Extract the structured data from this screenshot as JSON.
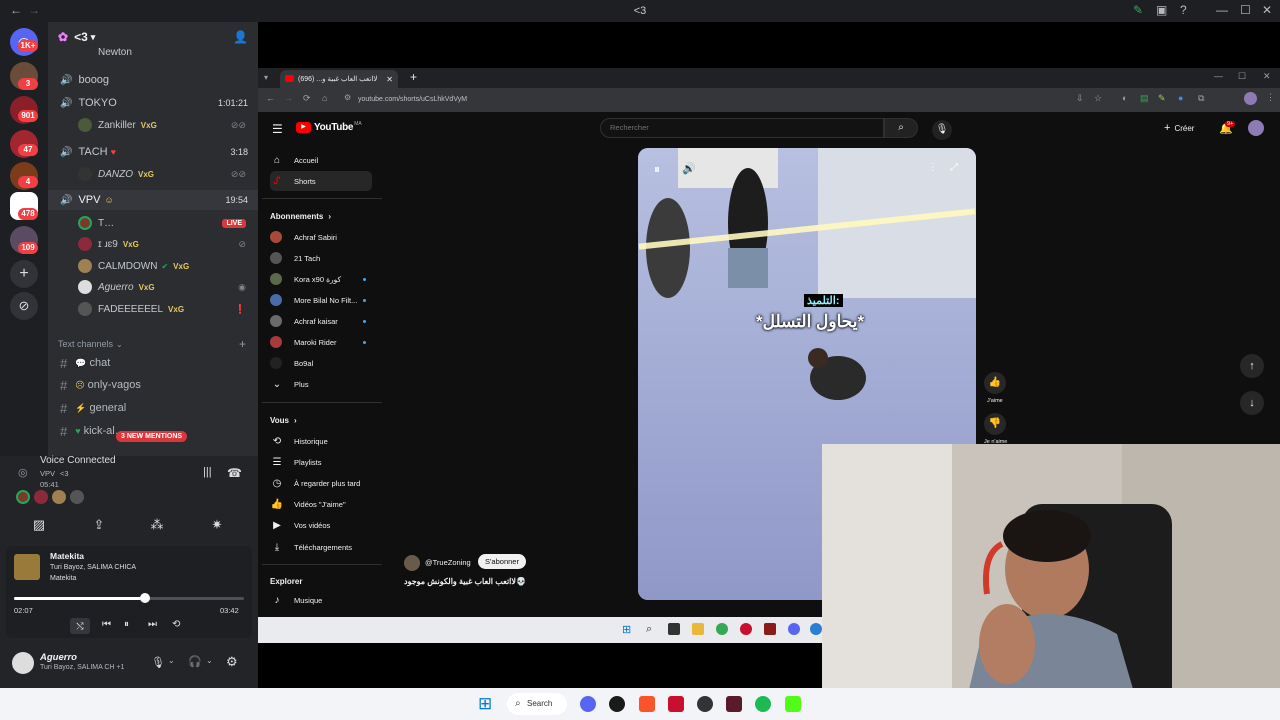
{
  "window": {
    "title": "<3"
  },
  "rail": {
    "badges": [
      "1K+",
      "3",
      "901",
      "47",
      "4",
      "478",
      "109"
    ]
  },
  "server": {
    "name": "<3",
    "top_cut_user": "Newton",
    "voice_channels": [
      {
        "name": "booog",
        "time": ""
      },
      {
        "name": "TOKYO",
        "time": "1:01:21"
      },
      {
        "name": "TACH",
        "time": "3:18"
      },
      {
        "name": "VPV",
        "time": "19:54"
      }
    ],
    "tokyo_user": {
      "name": "Zankiller",
      "tag": "VxG"
    },
    "tach_user": {
      "name": "DANZO",
      "tag": "VxG"
    },
    "vpv_users": [
      {
        "name": "T…",
        "tag": "",
        "live": "LIVE"
      },
      {
        "name": "ɪ ɹɛ9",
        "tag": "VxG",
        "live": ""
      },
      {
        "name": "CALMDOWN",
        "tag": "VxG",
        "live": ""
      },
      {
        "name": "Aguerro",
        "tag": "VxG",
        "live": ""
      },
      {
        "name": "FADEEEEEEL",
        "tag": "VxG",
        "live": ""
      }
    ],
    "text_channels_header": "Text channels",
    "text_channels": [
      "chat",
      "only-vagos",
      "general",
      "kick-al…"
    ],
    "mentions_badge": "3 NEW MENTIONS"
  },
  "voice": {
    "status": "Voice Connected",
    "channel": "VPV",
    "server": "<3",
    "elapsed": "05:41"
  },
  "spotify": {
    "track": "Matekita",
    "artists": "Turi Bayoz, SALIMA CHICA",
    "album": "Matekita",
    "position": "02:07",
    "duration": "03:42",
    "progress_fraction": 0.57
  },
  "user": {
    "name": "Aguerro",
    "activity": "Turi Bayoz, SALIMA CH +1"
  },
  "browser": {
    "tab_title": "لااتعب العاب غبية و... (696)",
    "new_tab": "+",
    "url": "youtube.com/shorts/uCsLhkVdVyM"
  },
  "youtube": {
    "logo": "YouTube",
    "logo_sup": "MA",
    "search_placeholder": "Rechercher",
    "create_label": "Créer",
    "notif_count": "9+",
    "nav": [
      {
        "icon": "home-icon",
        "label": "Accueil"
      },
      {
        "icon": "shorts-icon",
        "label": "Shorts"
      }
    ],
    "subs_header": "Abonnements",
    "subs": [
      "Achraf Sabiri",
      "21 Tach",
      "Kora x90 كورة",
      "More Bilal No Filt...",
      "Achraf kaisar",
      "Maroki Rider",
      "Bo9al"
    ],
    "more_label": "Plus",
    "you_header": "Vous",
    "you_items": [
      "Historique",
      "Playlists",
      "À regarder plus tard",
      "Vidéos \"J'aime\"",
      "Vos vidéos",
      "Téléchargements"
    ],
    "explore_header": "Explorer",
    "explore_items": [
      "Musique"
    ],
    "video_caption_top": "التلميذ:",
    "video_caption_main": "*يحاول التسلل*",
    "channel_handle": "@TrueZoning",
    "subscribe_label": "S'abonner",
    "video_title": "لااتعب العاب غبية والكونش موجود💀",
    "like_label": "J'aime",
    "dislike_label": "Je n'aime"
  },
  "taskbar": {
    "search_label": "Search"
  },
  "colors": {
    "discord_bg": "#2b2d31",
    "discord_rail": "#1e1f22",
    "accent_red": "#f23f43",
    "yt_red": "#ff0000",
    "yt_bg": "#0f0f0f"
  }
}
